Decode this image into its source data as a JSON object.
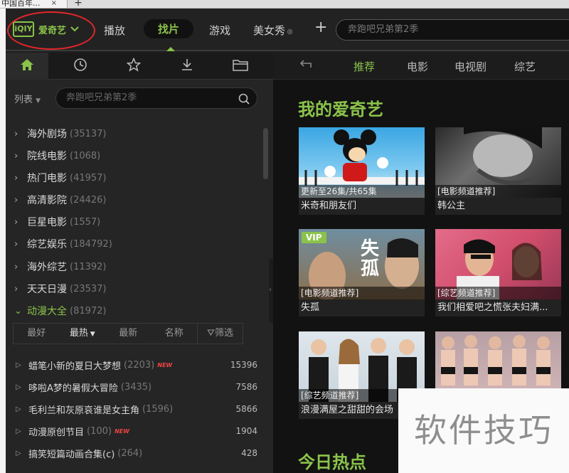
{
  "browser": {
    "tab_label": "中国百年...",
    "close": "×",
    "new_tab": "+"
  },
  "app": {
    "logo_mark": "iQIY",
    "logo_text": "爱奇艺",
    "nav_tabs": [
      {
        "label": "播放"
      },
      {
        "label": "找片"
      },
      {
        "label": "游戏"
      },
      {
        "label": "美女秀"
      }
    ],
    "plus": "+",
    "search_placeholder": "奔跑吧兄弟第2季"
  },
  "left": {
    "list_label": "列表",
    "search_placeholder": "奔跑吧兄弟第2季",
    "categories": [
      {
        "name": "海外剧场",
        "count": "(35137)"
      },
      {
        "name": "院线电影",
        "count": "(1068)"
      },
      {
        "name": "热门电影",
        "count": "(41957)"
      },
      {
        "name": "高清影院",
        "count": "(24426)"
      },
      {
        "name": "巨星电影",
        "count": "(1557)"
      },
      {
        "name": "综艺娱乐",
        "count": "(184792)"
      },
      {
        "name": "海外综艺",
        "count": "(11392)"
      },
      {
        "name": "天天日漫",
        "count": "(23537)"
      },
      {
        "name": "动漫大全",
        "count": "(81972)"
      }
    ],
    "filters": [
      "最好",
      "最热",
      "最新",
      "名称"
    ],
    "filter_button": "筛选",
    "items": [
      {
        "name": "蜡笔小新的夏日大梦想",
        "count": "(2203)",
        "new": "NEW",
        "views": "15396"
      },
      {
        "name": "哆啦A梦的暑假大冒险",
        "count": "(3435)",
        "new": "",
        "views": "7586"
      },
      {
        "name": "毛利兰和灰原哀谁是女主角",
        "count": "(1596)",
        "new": "",
        "views": "5866"
      },
      {
        "name": "动漫原创节目",
        "count": "(100)",
        "new": "NEW",
        "views": "1904"
      },
      {
        "name": "搞笑短篇动画合集(c)",
        "count": "(264)",
        "new": "",
        "views": "428"
      }
    ]
  },
  "right": {
    "tabs": [
      "推荐",
      "电影",
      "电视剧",
      "综艺"
    ],
    "section_title": "我的爱奇艺",
    "section2_title": "今日热点",
    "cards": [
      {
        "caption": "更新至26集/共65集",
        "title": "米奇和朋友们"
      },
      {
        "caption": "[电影频道推荐]",
        "title": "韩公主"
      },
      {
        "caption": "[电影频道推荐]",
        "title": "失孤",
        "badge": "VIP",
        "poster_text": "失孤"
      },
      {
        "caption": "[综艺频道推荐]",
        "title": "我们相爱吧之慌张夫妇满..."
      },
      {
        "caption": "[综艺频道推荐]",
        "title": "浪漫满屋之甜甜的会场"
      },
      {
        "caption": "",
        "title": ""
      }
    ]
  },
  "watermark": "软件技巧",
  "colors": {
    "accent": "#8bc34a",
    "ring": "#e2262b",
    "bg": "#1e1e1e"
  }
}
